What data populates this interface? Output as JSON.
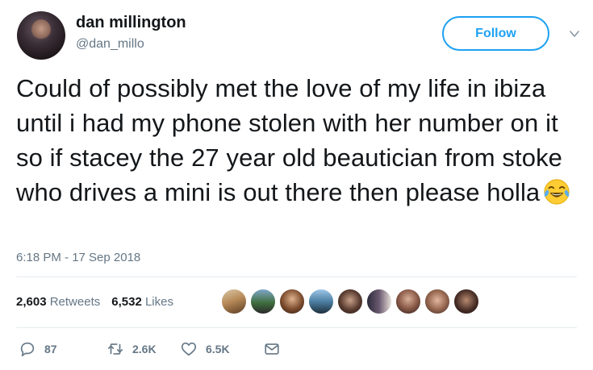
{
  "user": {
    "display_name": "dan millington",
    "handle": "@dan_millo"
  },
  "follow_button": {
    "label": "Follow"
  },
  "tweet": {
    "text": "Could of possibly met the love of my life in ibiza until i had my phone stolen with her number on it so if stacey the 27 year old beautician from stoke who drives a mini is out there then please holla",
    "emoji": "face-with-tears-of-joy",
    "timestamp": "6:18 PM - 17 Sep 2018"
  },
  "stats": {
    "retweets_count": "2,603",
    "retweets_label": "Retweets",
    "likes_count": "6,532",
    "likes_label": "Likes"
  },
  "liked_by_avatars": 9,
  "actions": {
    "replies": "87",
    "retweets": "2.6K",
    "likes": "6.5K"
  },
  "colors": {
    "accent": "#1da1f2",
    "text": "#14171a",
    "muted": "#657786",
    "divider": "#e6ecf0"
  },
  "icons": [
    "reply-icon",
    "retweet-icon",
    "like-icon",
    "direct-message-icon",
    "chevron-down-icon"
  ]
}
